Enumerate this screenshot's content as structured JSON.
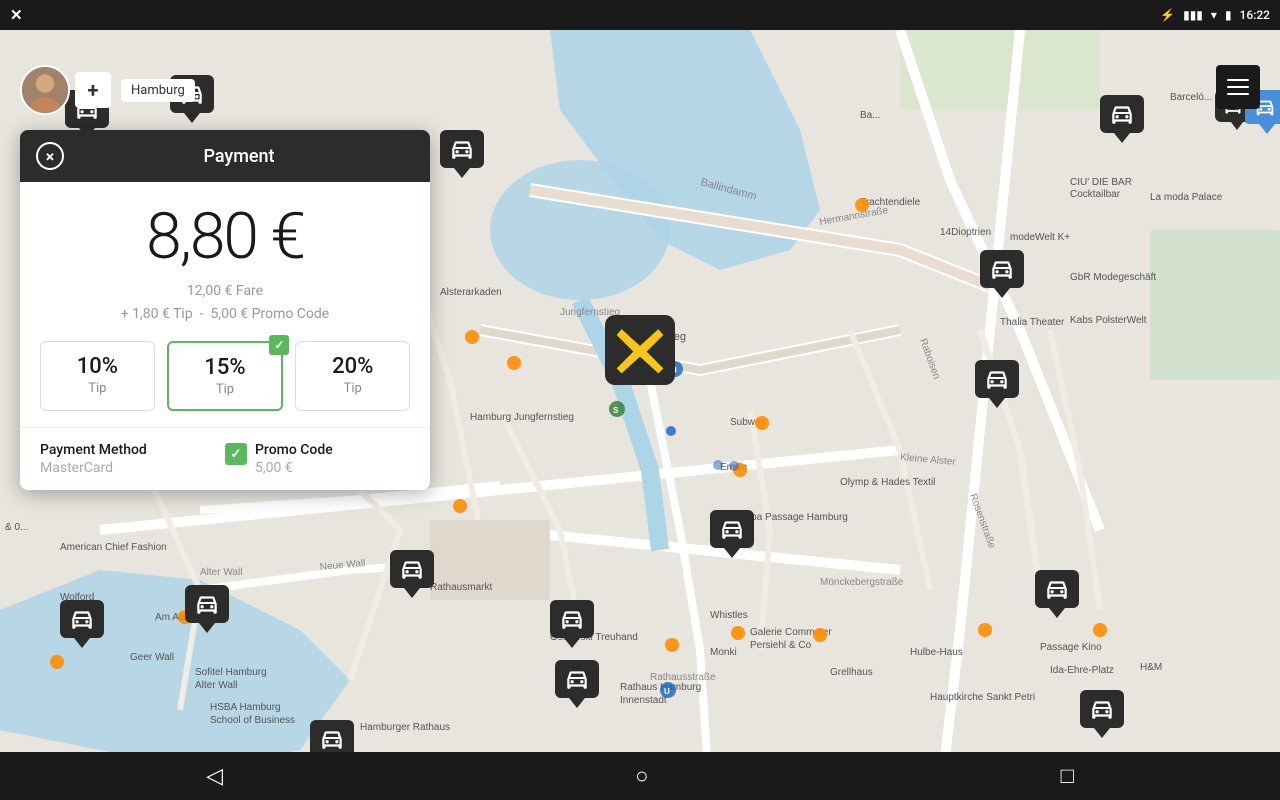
{
  "statusBar": {
    "time": "16:22",
    "icons": [
      "bluetooth",
      "signal",
      "wifi",
      "battery"
    ]
  },
  "nav": {
    "location": "Hamburg",
    "addLabel": "+",
    "menuLines": 3
  },
  "payment": {
    "header": {
      "title": "Payment",
      "closeLabel": "×"
    },
    "price": {
      "main": "8,80 €",
      "fare": "12,00 € Fare",
      "tip": "+ 1,80 € Tip",
      "promo": "5,00 € Promo Code"
    },
    "tips": [
      {
        "percent": "10%",
        "label": "Tip",
        "selected": false
      },
      {
        "percent": "15%",
        "label": "Tip",
        "selected": true
      },
      {
        "percent": "20%",
        "label": "Tip",
        "selected": false
      }
    ],
    "paymentMethod": {
      "title": "Payment Method",
      "value": "MasterCard"
    },
    "promoCode": {
      "title": "Promo Code",
      "value": "5,00 €"
    }
  },
  "androidNav": {
    "back": "◁",
    "home": "○",
    "recent": "□"
  }
}
